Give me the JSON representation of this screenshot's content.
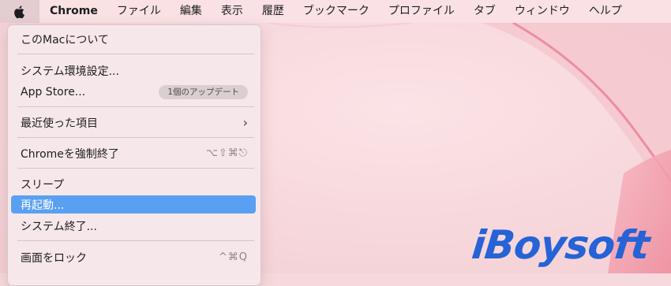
{
  "menubar": {
    "app_name": "Chrome",
    "menus": [
      "ファイル",
      "編集",
      "表示",
      "履歴",
      "ブックマーク",
      "プロファイル",
      "タブ",
      "ウィンドウ",
      "ヘルプ"
    ]
  },
  "apple_menu": {
    "about": "このMacについて",
    "system_prefs": "システム環境設定...",
    "app_store": "App Store...",
    "app_store_badge": "1個のアップデート",
    "recent_items": "最近使った項目",
    "force_quit": "Chromeを強制終了",
    "force_quit_shortcut": "⌥⇧⌘⎋",
    "sleep": "スリープ",
    "restart": "再起動...",
    "shutdown": "システム終了...",
    "lock_screen": "画面をロック",
    "lock_screen_shortcut": "^⌘Q"
  },
  "watermark": {
    "text": "iBoysoft"
  },
  "colors": {
    "highlight": "#5aa0f2",
    "desktop": "#f6d9dc",
    "logo": "#2563d6"
  }
}
